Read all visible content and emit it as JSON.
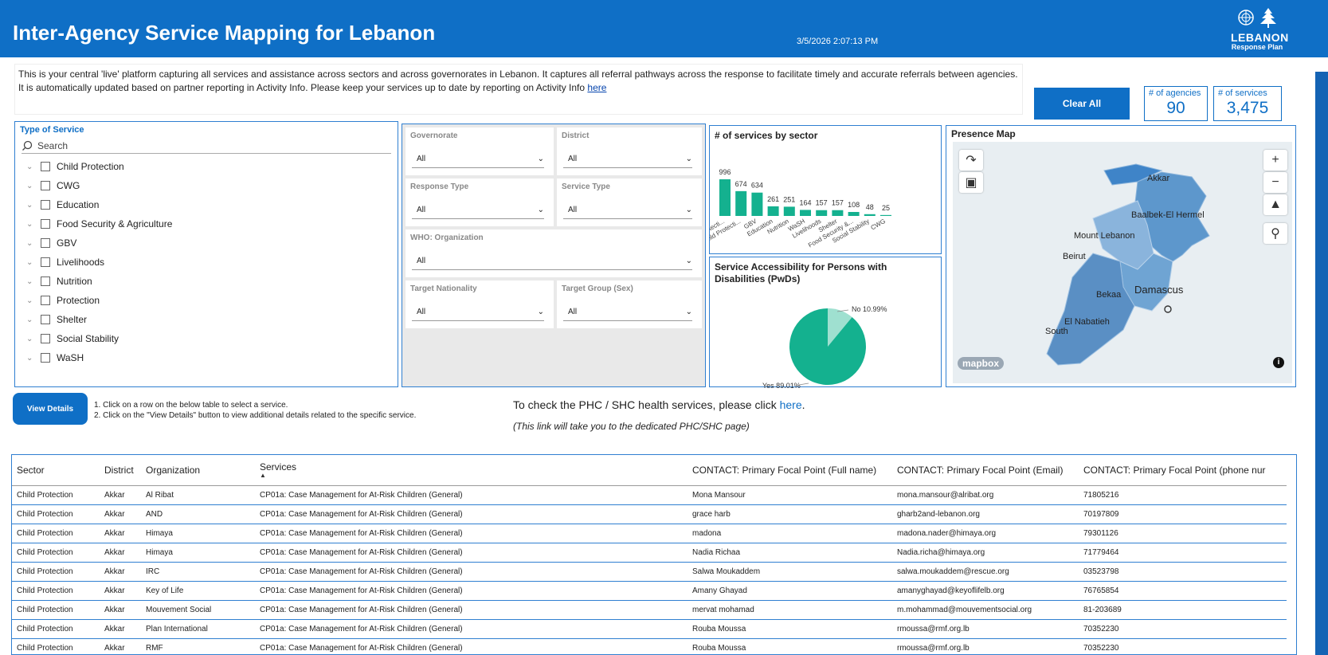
{
  "header": {
    "title": "Inter-Agency Service Mapping for Lebanon",
    "timestamp": "3/5/2026 2:07:13 PM",
    "logo_line1": "LEBANON",
    "logo_line2": "Response Plan"
  },
  "intro": {
    "text": "This is your central 'live' platform capturing all services and assistance across sectors and across governorates in Lebanon. It captures all referral pathways across the response to facilitate timely and accurate referrals between agencies. It is automatically updated based on partner reporting in Activity Info. Please keep your services up to date by reporting on Activity Info ",
    "link": "here"
  },
  "clear_all": "Clear All",
  "kpis": {
    "agencies_label": "# of agencies",
    "agencies_value": "90",
    "services_label": "# of services",
    "services_value": "3,475"
  },
  "type_of_service": {
    "title": "Type of Service",
    "search_placeholder": "Search",
    "items": [
      "Child Protection",
      "CWG",
      "Education",
      "Food Security & Agriculture",
      "GBV",
      "Livelihoods",
      "Nutrition",
      "Protection",
      "Shelter",
      "Social Stability",
      "WaSH"
    ]
  },
  "filters": {
    "governorate": {
      "label": "Governorate",
      "value": "All"
    },
    "district": {
      "label": "District",
      "value": "All"
    },
    "response_type": {
      "label": "Response Type",
      "value": "All"
    },
    "service_type": {
      "label": "Service Type",
      "value": "All"
    },
    "organization": {
      "label": "WHO: Organization",
      "value": "All"
    },
    "target_nationality": {
      "label": "Target Nationality",
      "value": "All"
    },
    "target_group": {
      "label": "Target Group (Sex)",
      "value": "All"
    }
  },
  "colors": {
    "brand": "#0f6fc6",
    "teal": "#14b18f",
    "teal_light": "#9fe0d0"
  },
  "chart_data": [
    {
      "type": "bar",
      "title": "# of services by sector",
      "categories": [
        "Protecti...",
        "Child Protecti...",
        "GBV",
        "Education",
        "Nutrition",
        "WaSH",
        "Livelihoods",
        "Shelter",
        "Food Security &...",
        "Social Stability",
        "CWG"
      ],
      "values": [
        996,
        674,
        634,
        261,
        251,
        164,
        157,
        157,
        108,
        48,
        25
      ],
      "ylim": [
        0,
        996
      ]
    },
    {
      "type": "pie",
      "title": "Service Accessibility for Persons with Disabilities (PwDs)",
      "categories": [
        "No",
        "Yes"
      ],
      "values": [
        10.99,
        89.01
      ],
      "labels": [
        "No 10.99%",
        "Yes 89.01%"
      ]
    }
  ],
  "map": {
    "title": "Presence Map",
    "labels": [
      "Akkar",
      "Baalbek-El Hermel",
      "Mount Lebanon",
      "Beirut",
      "Bekaa",
      "Damascus",
      "El Nabatieh",
      "South"
    ],
    "attribution": "mapbox"
  },
  "view_details": "View Details",
  "instructions": [
    "1. Click on a row on the below table to select a service.",
    "2. Click on the \"View Details\" button to view additional details related to the specific service."
  ],
  "phc": {
    "line1_prefix": "To check the PHC / SHC health services, please click ",
    "line1_link": "here",
    "line1_suffix": ".",
    "line2": "(This link will take you to the dedicated PHC/SHC page)"
  },
  "table": {
    "headers": [
      "Sector",
      "District",
      "Organization",
      "Services",
      "CONTACT: Primary Focal Point (Full name)",
      "CONTACT: Primary Focal Point (Email)",
      "CONTACT: Primary Focal Point (phone nur"
    ],
    "rows": [
      [
        "Child Protection",
        "Akkar",
        "Al Ribat",
        "CP01a: Case Management for At-Risk Children (General)",
        "Mona Mansour",
        "mona.mansour@alribat.org",
        "71805216"
      ],
      [
        "Child Protection",
        "Akkar",
        "AND",
        "CP01a: Case Management for At-Risk Children (General)",
        "grace harb",
        "gharb2and-lebanon.org",
        "70197809"
      ],
      [
        "Child Protection",
        "Akkar",
        "Himaya",
        "CP01a: Case Management for At-Risk Children (General)",
        "madona",
        "madona.nader@himaya.org",
        "79301126"
      ],
      [
        "Child Protection",
        "Akkar",
        "Himaya",
        "CP01a: Case Management for At-Risk Children (General)",
        "Nadia Richaa",
        "Nadia.richa@himaya.org",
        "71779464"
      ],
      [
        "Child Protection",
        "Akkar",
        "IRC",
        "CP01a: Case Management for At-Risk Children (General)",
        "Salwa Moukaddem",
        "salwa.moukaddem@rescue.org",
        "03523798"
      ],
      [
        "Child Protection",
        "Akkar",
        "Key of Life",
        "CP01a: Case Management for At-Risk Children (General)",
        "Amany Ghayad",
        "amanyghayad@keyoflifelb.org",
        "76765854"
      ],
      [
        "Child Protection",
        "Akkar",
        "Mouvement Social",
        "CP01a: Case Management for At-Risk Children (General)",
        "mervat mohamad",
        "m.mohammad@mouvementsocial.org",
        "81-203689"
      ],
      [
        "Child Protection",
        "Akkar",
        "Plan International",
        "CP01a: Case Management for At-Risk Children (General)",
        "Rouba Moussa",
        "rmoussa@rmf.org.lb",
        "70352230"
      ],
      [
        "Child Protection",
        "Akkar",
        "RMF",
        "CP01a: Case Management for At-Risk Children (General)",
        "Rouba Moussa",
        "rmoussa@rmf.org.lb",
        "70352230"
      ]
    ]
  }
}
